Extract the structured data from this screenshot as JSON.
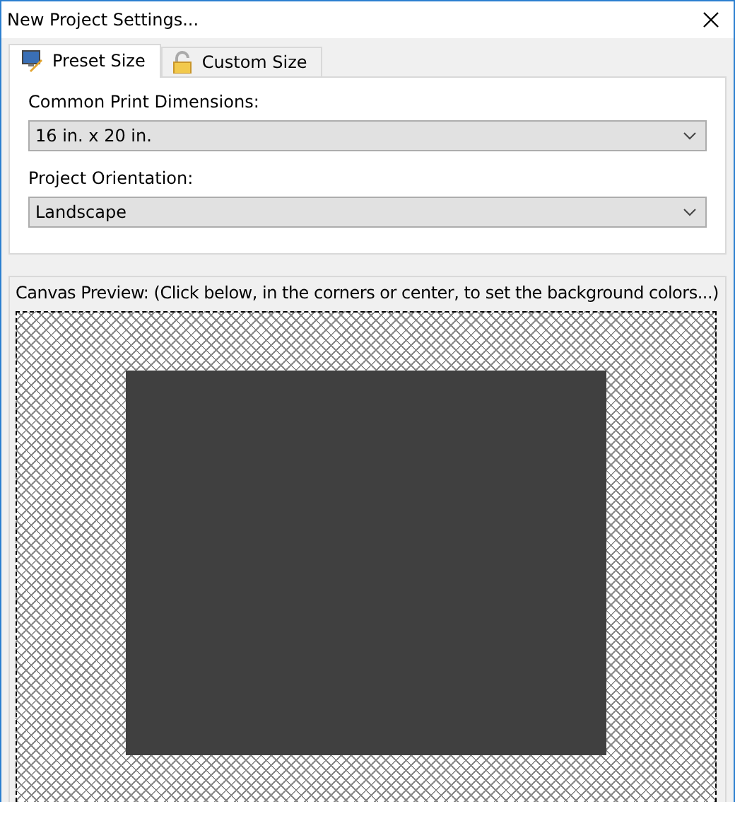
{
  "window": {
    "title": "New Project Settings..."
  },
  "tabs": [
    {
      "label": "Preset Size",
      "selected": true
    },
    {
      "label": "Custom Size",
      "selected": false
    }
  ],
  "fields": [
    {
      "label": "Common Print Dimensions:",
      "value": "16 in. x 20 in."
    },
    {
      "label": "Project Orientation:",
      "value": "Landscape"
    }
  ],
  "canvas_preview": {
    "label": "Canvas Preview: (Click below, in the corners or center, to set the background colors...)"
  }
}
